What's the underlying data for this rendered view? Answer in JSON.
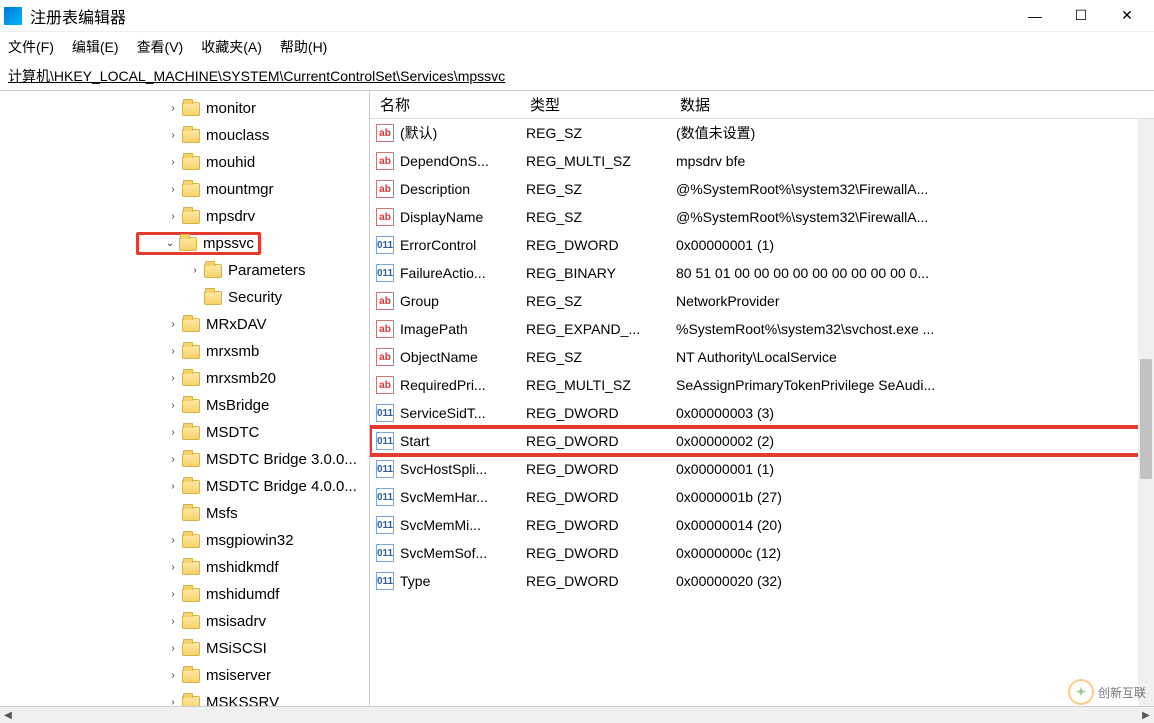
{
  "title": "注册表编辑器",
  "window_buttons": {
    "min": "—",
    "max": "☐",
    "close": "✕"
  },
  "menu": [
    "文件(F)",
    "编辑(E)",
    "查看(V)",
    "收藏夹(A)",
    "帮助(H)"
  ],
  "address": "计算机\\HKEY_LOCAL_MACHINE\\SYSTEM\\CurrentControlSet\\Services\\mpssvc",
  "tree": [
    {
      "indent": 3,
      "arrow": ">",
      "label": "monitor"
    },
    {
      "indent": 3,
      "arrow": ">",
      "label": "mouclass"
    },
    {
      "indent": 3,
      "arrow": ">",
      "label": "mouhid"
    },
    {
      "indent": 3,
      "arrow": ">",
      "label": "mountmgr"
    },
    {
      "indent": 3,
      "arrow": ">",
      "label": "mpsdrv"
    },
    {
      "indent": 3,
      "arrow": "v",
      "label": "mpssvc",
      "highlight": true
    },
    {
      "indent": 4,
      "arrow": ">",
      "label": "Parameters"
    },
    {
      "indent": 4,
      "arrow": "",
      "label": "Security"
    },
    {
      "indent": 3,
      "arrow": ">",
      "label": "MRxDAV"
    },
    {
      "indent": 3,
      "arrow": ">",
      "label": "mrxsmb"
    },
    {
      "indent": 3,
      "arrow": ">",
      "label": "mrxsmb20"
    },
    {
      "indent": 3,
      "arrow": ">",
      "label": "MsBridge"
    },
    {
      "indent": 3,
      "arrow": ">",
      "label": "MSDTC"
    },
    {
      "indent": 3,
      "arrow": ">",
      "label": "MSDTC Bridge 3.0.0..."
    },
    {
      "indent": 3,
      "arrow": ">",
      "label": "MSDTC Bridge 4.0.0..."
    },
    {
      "indent": 3,
      "arrow": "",
      "label": "Msfs"
    },
    {
      "indent": 3,
      "arrow": ">",
      "label": "msgpiowin32"
    },
    {
      "indent": 3,
      "arrow": ">",
      "label": "mshidkmdf"
    },
    {
      "indent": 3,
      "arrow": ">",
      "label": "mshidumdf"
    },
    {
      "indent": 3,
      "arrow": ">",
      "label": "msisadrv"
    },
    {
      "indent": 3,
      "arrow": ">",
      "label": "MSiSCSI"
    },
    {
      "indent": 3,
      "arrow": ">",
      "label": "msiserver"
    },
    {
      "indent": 3,
      "arrow": ">",
      "label": "MSKSSRV"
    }
  ],
  "columns": {
    "name": "名称",
    "type": "类型",
    "data": "数据"
  },
  "rows": [
    {
      "icon": "sz",
      "name": "(默认)",
      "type": "REG_SZ",
      "data": "(数值未设置)"
    },
    {
      "icon": "sz",
      "name": "DependOnS...",
      "type": "REG_MULTI_SZ",
      "data": "mpsdrv bfe"
    },
    {
      "icon": "sz",
      "name": "Description",
      "type": "REG_SZ",
      "data": "@%SystemRoot%\\system32\\FirewallA..."
    },
    {
      "icon": "sz",
      "name": "DisplayName",
      "type": "REG_SZ",
      "data": "@%SystemRoot%\\system32\\FirewallA..."
    },
    {
      "icon": "bin",
      "name": "ErrorControl",
      "type": "REG_DWORD",
      "data": "0x00000001 (1)"
    },
    {
      "icon": "bin",
      "name": "FailureActio...",
      "type": "REG_BINARY",
      "data": "80 51 01 00 00 00 00 00 00 00 00 00 0..."
    },
    {
      "icon": "sz",
      "name": "Group",
      "type": "REG_SZ",
      "data": "NetworkProvider"
    },
    {
      "icon": "sz",
      "name": "ImagePath",
      "type": "REG_EXPAND_...",
      "data": "%SystemRoot%\\system32\\svchost.exe ..."
    },
    {
      "icon": "sz",
      "name": "ObjectName",
      "type": "REG_SZ",
      "data": "NT Authority\\LocalService"
    },
    {
      "icon": "sz",
      "name": "RequiredPri...",
      "type": "REG_MULTI_SZ",
      "data": "SeAssignPrimaryTokenPrivilege SeAudi..."
    },
    {
      "icon": "bin",
      "name": "ServiceSidT...",
      "type": "REG_DWORD",
      "data": "0x00000003 (3)"
    },
    {
      "icon": "bin",
      "name": "Start",
      "type": "REG_DWORD",
      "data": "0x00000002 (2)",
      "highlight": true
    },
    {
      "icon": "bin",
      "name": "SvcHostSpli...",
      "type": "REG_DWORD",
      "data": "0x00000001 (1)"
    },
    {
      "icon": "bin",
      "name": "SvcMemHar...",
      "type": "REG_DWORD",
      "data": "0x0000001b (27)"
    },
    {
      "icon": "bin",
      "name": "SvcMemMi...",
      "type": "REG_DWORD",
      "data": "0x00000014 (20)"
    },
    {
      "icon": "bin",
      "name": "SvcMemSof...",
      "type": "REG_DWORD",
      "data": "0x0000000c (12)"
    },
    {
      "icon": "bin",
      "name": "Type",
      "type": "REG_DWORD",
      "data": "0x00000020 (32)"
    }
  ],
  "watermark": "创新互联"
}
